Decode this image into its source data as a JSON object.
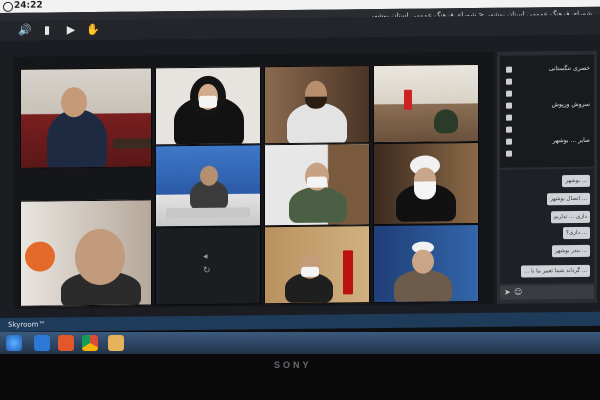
{
  "titlebar": {
    "time": "24:22"
  },
  "appbar": {
    "room_title": "شورای فرهنگ عمومی استان بوشهر < شورای فرهنگ عمومی استان بوشهر"
  },
  "toolbar": {
    "icons": [
      "speaker-icon",
      "camera-icon",
      "screen-share-icon",
      "raise-hand-icon"
    ]
  },
  "participants": [
    {
      "name": "خضری تنگستانی"
    },
    {
      "name": ""
    },
    {
      "name": ""
    },
    {
      "name": "سروش ورپوش"
    },
    {
      "name": ""
    },
    {
      "name": ""
    },
    {
      "name": "صابر ... بوشهر"
    },
    {
      "name": ""
    }
  ],
  "chat": {
    "messages": [
      "... بوشهر",
      "... اتصال بوشهر",
      "داری ... تداریم",
      "... داری؟",
      "... بندر بوشهر",
      "... گرداند شما تغییر ما با ..."
    ]
  },
  "statusbar": {
    "brand": "Skyroom™"
  },
  "bezel": {
    "logo": "SONY"
  },
  "colors": {
    "accent": "#1f3b5a",
    "panel": "#2b2d33"
  }
}
